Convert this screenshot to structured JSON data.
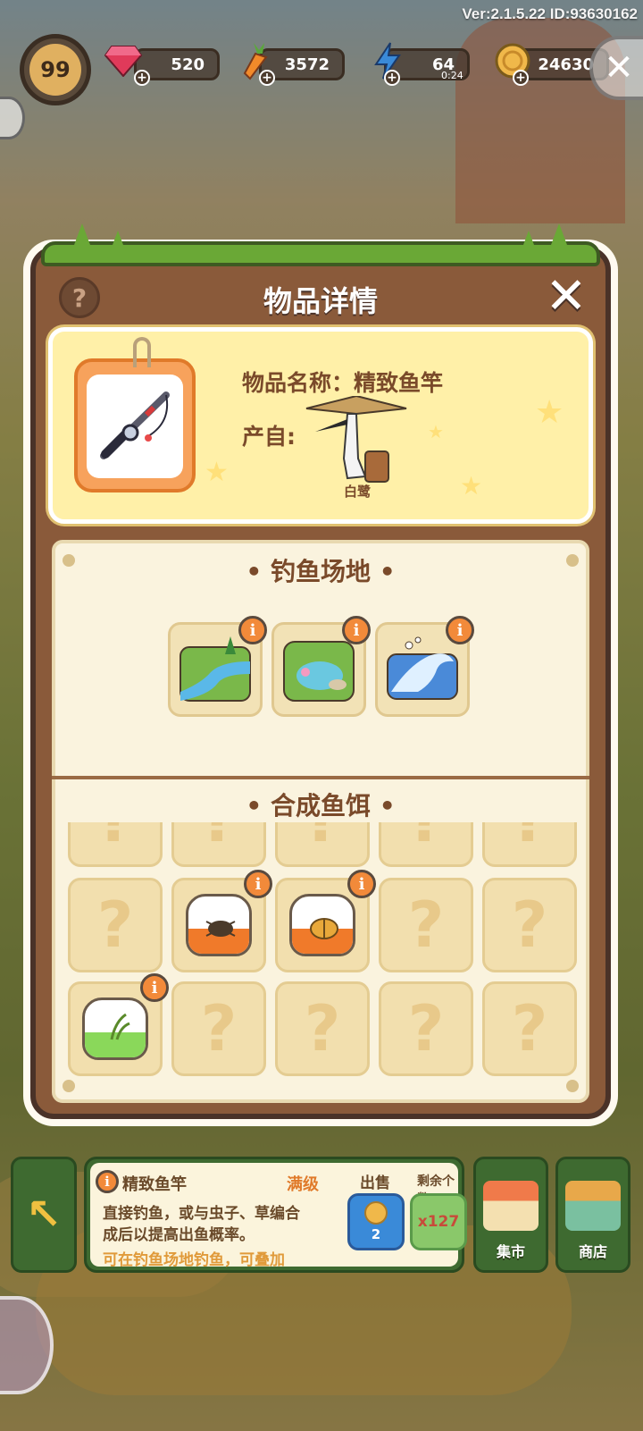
{
  "version_text": "Ver:2.1.5.22 ID:93630162",
  "hud": {
    "level": "99",
    "gems": "520",
    "carrots": "3572",
    "energy": "64",
    "energy_timer": "0:24",
    "coins": "24630",
    "icons": [
      "gem-icon",
      "carrot-icon",
      "lightning-icon",
      "coin-icon"
    ]
  },
  "panel": {
    "title": "物品详情",
    "help_label": "?",
    "close_label": "✕",
    "item": {
      "name_line": "物品名称：精致鱼竿",
      "from_label": "产自:",
      "producer_name": "白鹭"
    },
    "sections": {
      "fishing_spots": "• 钓鱼场地 •",
      "bait": "• 合成鱼饵 •"
    },
    "locations": [
      "river",
      "pond",
      "sea"
    ],
    "bait_rows": [
      [
        "locked",
        "locked",
        "locked",
        "locked",
        "locked"
      ],
      [
        "locked",
        "bug-bait",
        "beetle-bait",
        "locked",
        "locked"
      ],
      [
        "grass-bait",
        "locked",
        "locked",
        "locked",
        "locked"
      ]
    ],
    "locked_symbol": "?",
    "info_symbol": "i"
  },
  "bottom": {
    "item_title": "精致鱼竿",
    "item_level": "满级",
    "desc_line1": "直接钓鱼，或与虫子、草编合",
    "desc_line2": "成后以提高出鱼概率。",
    "desc_line3": "可在钓鱼场地钓鱼，可叠加",
    "sell_label": "出售",
    "sell_price": "2",
    "remain_label": "剩余个数",
    "remain_count": "x127",
    "market_label": "集市",
    "shop_label": "商店"
  },
  "colors": {
    "panel_brown": "#8a5a3a",
    "card_yellow": "#fff0a8",
    "accent_orange": "#f28a3a",
    "grass_green": "#6aa836"
  }
}
